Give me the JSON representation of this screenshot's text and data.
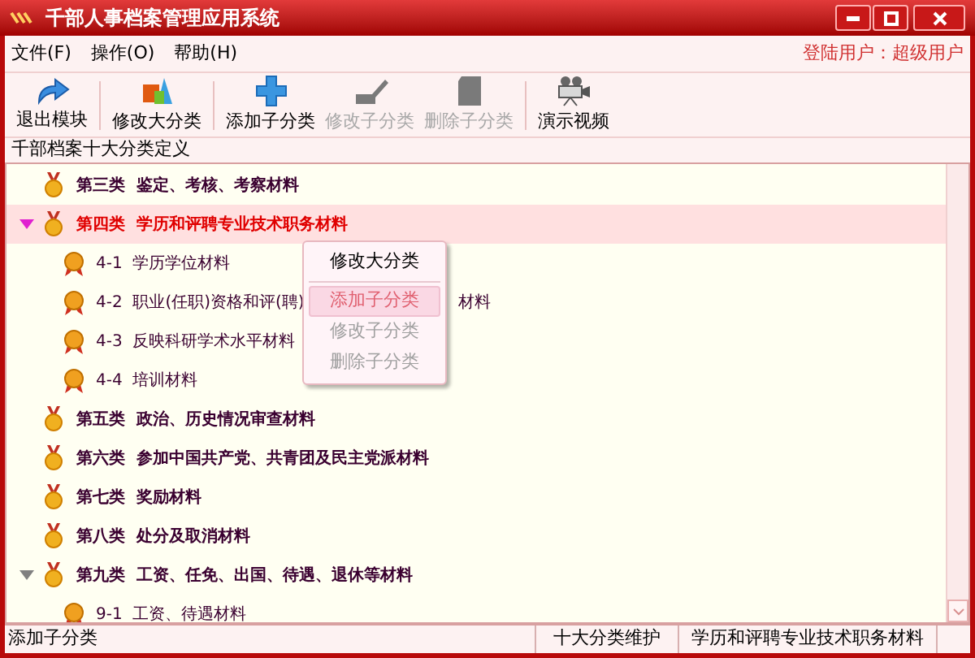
{
  "window": {
    "title": "千部人事档案管理应用系统"
  },
  "menu": [
    {
      "label": "文件(F)"
    },
    {
      "label": "操作(O)"
    },
    {
      "label": "帮助(H)"
    }
  ],
  "user": "登陆用户：超级用户",
  "toolbar": [
    {
      "kind": "exit",
      "label": "退出模块",
      "disabled": false,
      "separator_after": true
    },
    {
      "kind": "shapes",
      "label": "修改大分类",
      "disabled": false,
      "separator_after": true
    },
    {
      "kind": "plus",
      "label": "添加子分类",
      "disabled": false,
      "separator_after": false
    },
    {
      "kind": "edit",
      "label": "修改子分类",
      "disabled": true,
      "separator_after": false
    },
    {
      "kind": "delete",
      "label": "删除子分类",
      "disabled": true,
      "separator_after": true
    },
    {
      "kind": "camera",
      "label": "演示视频",
      "disabled": false,
      "separator_after": false
    }
  ],
  "section_title": "千部档案十大分类定义",
  "tree": [
    {
      "number": "第三类",
      "title": "鉴定、考核、考察材料",
      "selected": false,
      "expanded": false
    },
    {
      "number": "第四类",
      "title": "学历和评聘专业技术职务材料",
      "selected": true,
      "expanded": true,
      "children": [
        {
          "number": "4-1",
          "title": "学历学位材料"
        },
        {
          "number": "4-2",
          "title": "职业(任职)资格和评(聘)",
          "tail": "材料"
        },
        {
          "number": "4-3",
          "title": "反映科研学术水平材料"
        },
        {
          "number": "4-4",
          "title": "培训材料"
        }
      ]
    },
    {
      "number": "第五类",
      "title": "政治、历史情况审查材料",
      "selected": false,
      "expanded": false
    },
    {
      "number": "第六类",
      "title": "参加中国共产党、共青团及民主党派材料",
      "selected": false,
      "expanded": false
    },
    {
      "number": "第七类",
      "title": "奖励材料",
      "selected": false,
      "expanded": false
    },
    {
      "number": "第八类",
      "title": "处分及取消材料",
      "selected": false,
      "expanded": false
    },
    {
      "number": "第九类",
      "title": "工资、任免、出国、待遇、退休等材料",
      "selected": false,
      "expanded": true,
      "children": [
        {
          "number": "9-1",
          "title": "工资、待遇材料"
        }
      ]
    }
  ],
  "context_menu": [
    {
      "label": "修改大分类",
      "disabled": false,
      "selected": false,
      "separator_after": true
    },
    {
      "label": "添加子分类",
      "disabled": false,
      "selected": true,
      "separator_after": false
    },
    {
      "label": "修改子分类",
      "disabled": true,
      "selected": false,
      "separator_after": false
    },
    {
      "label": "删除子分类",
      "disabled": true,
      "selected": false,
      "separator_after": false
    }
  ],
  "status_bar": [
    "添加子分类",
    "十大分类维护",
    "学历和评聘专业技术职务材料"
  ]
}
